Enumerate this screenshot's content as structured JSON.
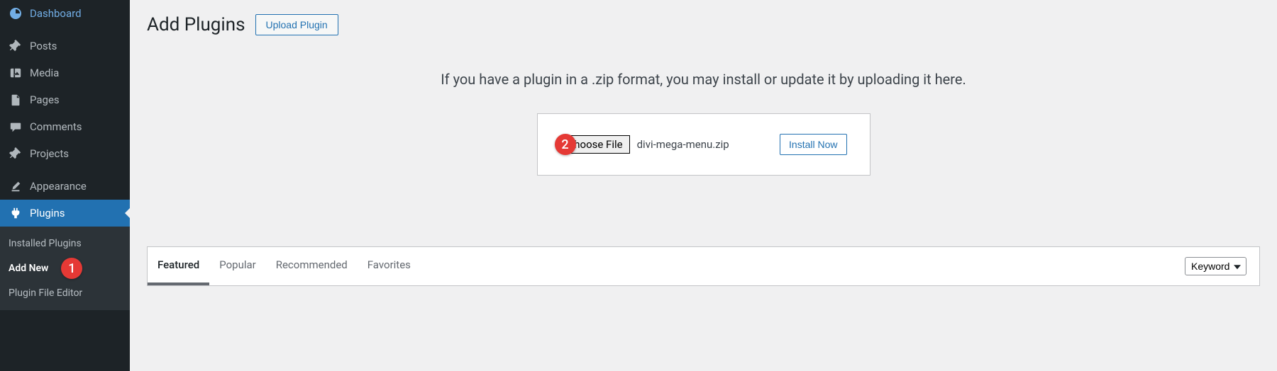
{
  "sidebar": {
    "items": [
      {
        "label": "Dashboard"
      },
      {
        "label": "Posts"
      },
      {
        "label": "Media"
      },
      {
        "label": "Pages"
      },
      {
        "label": "Comments"
      },
      {
        "label": "Projects"
      },
      {
        "label": "Appearance"
      },
      {
        "label": "Plugins"
      }
    ],
    "submenu": [
      {
        "label": "Installed Plugins"
      },
      {
        "label": "Add New"
      },
      {
        "label": "Plugin File Editor"
      }
    ]
  },
  "header": {
    "title": "Add Plugins",
    "upload_button": "Upload Plugin"
  },
  "upload": {
    "helper_text": "If you have a plugin in a .zip format, you may install or update it by uploading it here.",
    "choose_file": "Choose File",
    "file_name": "divi-mega-menu.zip",
    "install": "Install Now"
  },
  "filter": {
    "tabs": [
      "Featured",
      "Popular",
      "Recommended",
      "Favorites"
    ],
    "search_type": "Keyword"
  },
  "annotations": {
    "marker1": "1",
    "marker2": "2"
  }
}
